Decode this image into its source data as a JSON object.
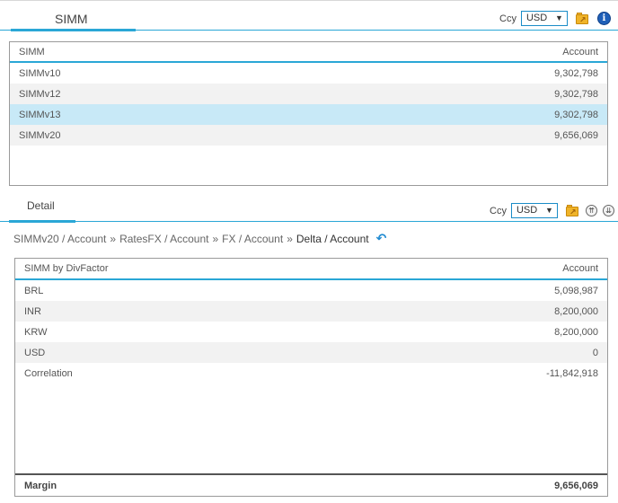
{
  "top_tab": {
    "label": "SIMM"
  },
  "top_ccy": {
    "label": "Ccy",
    "value": "USD"
  },
  "simm_grid": {
    "columns": [
      "SIMM",
      "Account"
    ],
    "rows": [
      {
        "name": "SIMMv10",
        "value": "9,302,798"
      },
      {
        "name": "SIMMv12",
        "value": "9,302,798"
      },
      {
        "name": "SIMMv13",
        "value": "9,302,798"
      },
      {
        "name": "SIMMv20",
        "value": "9,656,069"
      }
    ],
    "selected_row": "SIMMv13"
  },
  "detail_tab": {
    "label": "Detail"
  },
  "detail_ccy": {
    "label": "Ccy",
    "value": "USD"
  },
  "breadcrumb": {
    "items": [
      "SIMMv20 / Account",
      "RatesFX / Account",
      "FX / Account",
      "Delta / Account"
    ],
    "separator": "»"
  },
  "detail_grid": {
    "columns": [
      "SIMM by DivFactor",
      "Account"
    ],
    "rows": [
      {
        "name": "BRL",
        "value": "5,098,987"
      },
      {
        "name": "INR",
        "value": "8,200,000"
      },
      {
        "name": "KRW",
        "value": "8,200,000"
      },
      {
        "name": "USD",
        "value": "0"
      },
      {
        "name": "Correlation",
        "value": "-11,842,918"
      }
    ],
    "footer": {
      "name": "Margin",
      "value": "9,656,069"
    }
  },
  "icons": {
    "export": "folder-export-icon",
    "info": "info-icon",
    "collapse_up": "double-chevron-up-icon",
    "collapse_down": "double-chevron-down-icon",
    "back": "undo-arrow-icon"
  },
  "colors": {
    "accent": "#2aa7d6",
    "selected_row": "#c8e9f7",
    "alt_row": "#f2f2f2"
  }
}
